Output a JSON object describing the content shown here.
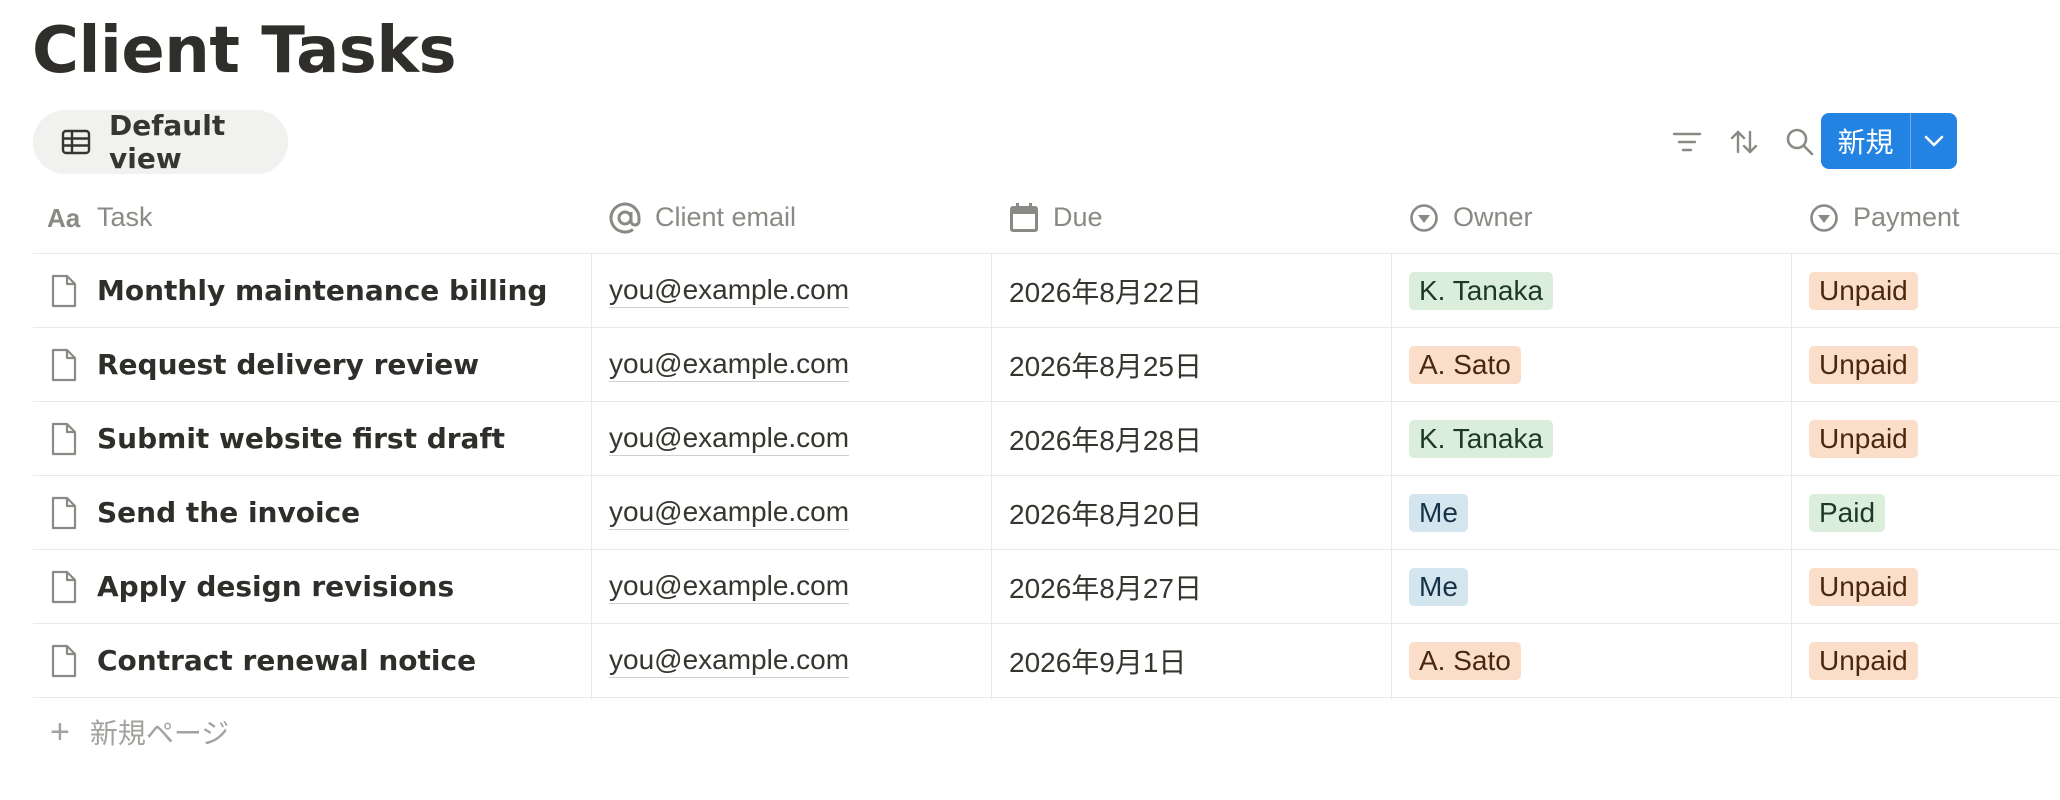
{
  "page": {
    "title": "Client Tasks"
  },
  "view": {
    "label": "Default view",
    "icon": "table-icon"
  },
  "toolbar": {
    "icons": [
      "filter-icon",
      "sort-icon",
      "search-icon"
    ],
    "new_label": "新規",
    "accent": "#2383e2"
  },
  "table": {
    "headers": [
      {
        "label": "Task",
        "icon": "title-aa-icon"
      },
      {
        "label": "Client email",
        "icon": "at-sign-icon"
      },
      {
        "label": "Due",
        "icon": "calendar-icon"
      },
      {
        "label": "Owner",
        "icon": "select-icon"
      },
      {
        "label": "Payment",
        "icon": "select-icon"
      }
    ],
    "rows": [
      {
        "task": "Monthly maintenance billing",
        "email": "you@example.com",
        "due": "2026年8月22日",
        "owner": "K. Tanaka",
        "payment": "Unpaid"
      },
      {
        "task": "Request delivery review",
        "email": "you@example.com",
        "due": "2026年8月25日",
        "owner": "A. Sato",
        "payment": "Unpaid"
      },
      {
        "task": "Submit website first draft",
        "email": "you@example.com",
        "due": "2026年8月28日",
        "owner": "K. Tanaka",
        "payment": "Unpaid"
      },
      {
        "task": "Send the invoice",
        "email": "you@example.com",
        "due": "2026年8月20日",
        "owner": "Me",
        "payment": "Paid"
      },
      {
        "task": "Apply design revisions",
        "email": "you@example.com",
        "due": "2026年8月27日",
        "owner": "Me",
        "payment": "Unpaid"
      },
      {
        "task": "Contract renewal notice",
        "email": "you@example.com",
        "due": "2026年9月1日",
        "owner": "A. Sato",
        "payment": "Unpaid"
      }
    ],
    "tag_colors": {
      "K. Tanaka": {
        "bg": "#dbeddb",
        "fg": "#1c3829"
      },
      "A. Sato": {
        "bg": "#fadec9",
        "fg": "#49290e"
      },
      "Me": {
        "bg": "#d3e5ef",
        "fg": "#183347"
      },
      "Unpaid": {
        "bg": "#fadec9",
        "fg": "#49290e"
      },
      "Paid": {
        "bg": "#dbeddb",
        "fg": "#1c3829"
      }
    },
    "add_label": "新規ページ"
  }
}
